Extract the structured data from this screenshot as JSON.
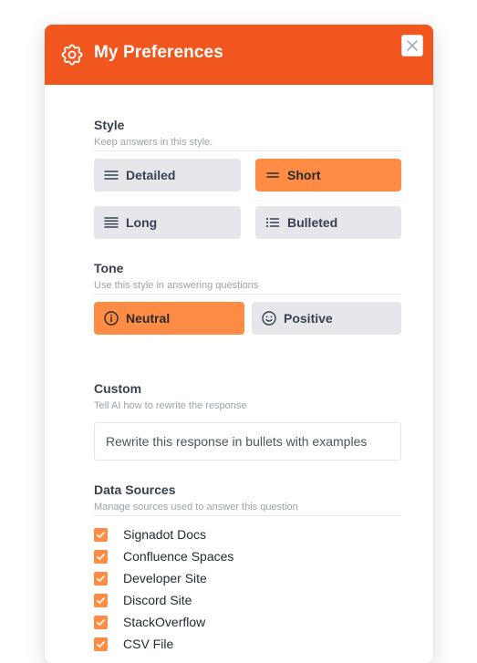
{
  "header": {
    "title": "My Preferences",
    "icon": "gear-icon",
    "background": "#f0561d"
  },
  "style": {
    "title": "Style",
    "subtitle": "Keep answers in this style.",
    "options": [
      {
        "label": "Detailed",
        "icon": "detailed-lines-icon",
        "selected": false
      },
      {
        "label": "Short",
        "icon": "short-lines-icon",
        "selected": true
      },
      {
        "label": "Long",
        "icon": "long-lines-icon",
        "selected": false
      },
      {
        "label": "Bulleted",
        "icon": "bulleted-list-icon",
        "selected": false
      }
    ]
  },
  "tone": {
    "title": "Tone",
    "subtitle": "Use this style in answering questions",
    "options": [
      {
        "label": "Neutral",
        "icon": "info-circle-icon",
        "selected": true
      },
      {
        "label": "Positive",
        "icon": "smile-icon",
        "selected": false
      }
    ]
  },
  "custom": {
    "title": "Custom",
    "subtitle": "Tell AI how to rewrite the response",
    "placeholder": "Rewrite this response in bullets with examples"
  },
  "sources": {
    "title": "Data Sources",
    "subtitle": "Manage sources used to answer this question",
    "items": [
      {
        "label": "Signadot Docs",
        "checked": true
      },
      {
        "label": "Confluence Spaces",
        "checked": true
      },
      {
        "label": "Developer Site",
        "checked": true
      },
      {
        "label": "Discord Site",
        "checked": true
      },
      {
        "label": "StackOverflow",
        "checked": true
      },
      {
        "label": "CSV File",
        "checked": true
      }
    ]
  },
  "colors": {
    "accent": "#ff8c44",
    "brand": "#f0561d",
    "option_bg": "#e5e7eb"
  }
}
